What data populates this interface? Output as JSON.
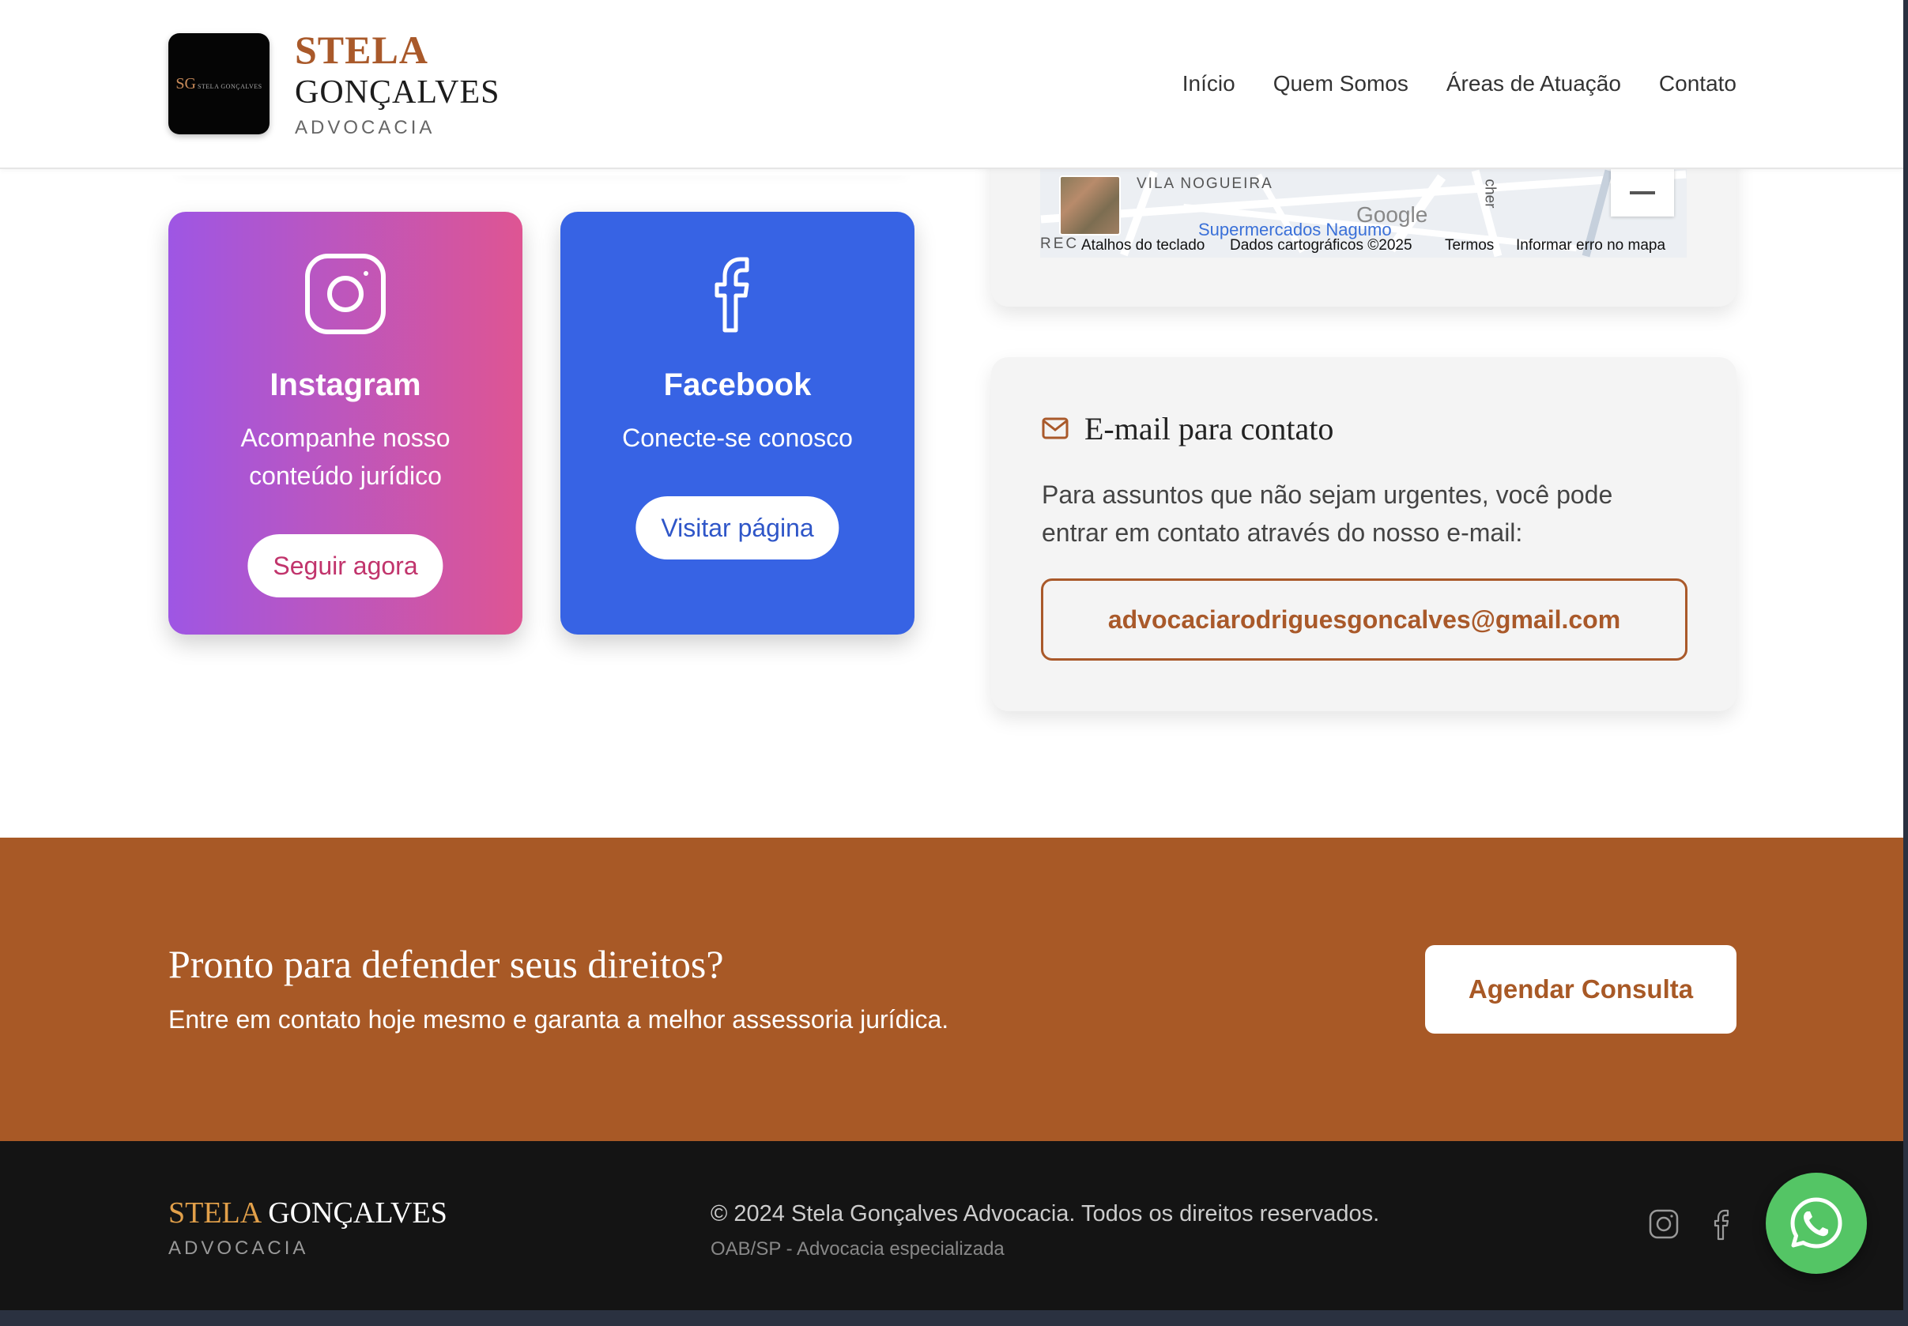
{
  "header": {
    "brand_line1": "STELA",
    "brand_line2": "GONÇALVES",
    "brand_line3": "ADVOCACIA",
    "logo_mark": "SG",
    "logo_mark_small": "STELA GONÇALVES",
    "nav": [
      {
        "label": "Início"
      },
      {
        "label": "Quem Somos"
      },
      {
        "label": "Áreas de Atuação"
      },
      {
        "label": "Contato"
      }
    ]
  },
  "social": {
    "instagram": {
      "icon": "instagram-icon",
      "title": "Instagram",
      "description": "Acompanhe nosso conteúdo jurídico",
      "button": "Seguir agora"
    },
    "facebook": {
      "icon": "facebook-icon",
      "title": "Facebook",
      "description": "Conecte-se conosco",
      "button": "Visitar página"
    }
  },
  "map": {
    "label_vila": "VILA NOGUEIRA",
    "label_rec": "REC",
    "label_road": "cher",
    "poi": "Supermercados Nagumo",
    "google": "Google",
    "attrib_shortcuts": "Atalhos do teclado",
    "attrib_data": "Dados cartográficos ©2025",
    "attrib_terms": "Termos",
    "attrib_report": "Informar erro no mapa"
  },
  "email": {
    "icon": "mail-icon",
    "title": "E-mail para contato",
    "description": "Para assuntos que não sejam urgentes, você pode entrar em contato através do nosso e-mail:",
    "address": "advocaciarodriguesgoncalves@gmail.com"
  },
  "cta": {
    "title": "Pronto para defender seus direitos?",
    "subtitle": "Entre em contato hoje mesmo e garanta a melhor assessoria jurídica.",
    "button": "Agendar Consulta"
  },
  "footer": {
    "brand_part1": "STELA",
    "brand_part2": "GONÇALVES",
    "brand_sub": "ADVOCACIA",
    "copyright": "© 2024 Stela Gonçalves Advocacia. Todos os direitos reservados.",
    "oab": "OAB/SP - Advocacia especializada"
  },
  "colors": {
    "brand": "#a85926",
    "instagram_from": "#9e56e4",
    "instagram_to": "#de5593",
    "facebook": "#3763e4",
    "whatsapp": "#54c565",
    "footer_bg": "#141414"
  }
}
